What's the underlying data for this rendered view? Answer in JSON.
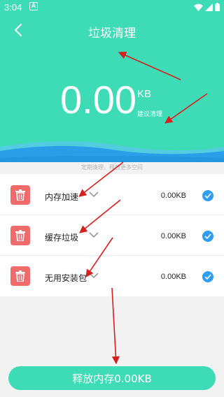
{
  "status_bar": {
    "time": "3:04",
    "notification_letter": "A"
  },
  "header": {
    "title": "垃圾清理"
  },
  "summary": {
    "value": "0.00",
    "unit": "KB",
    "subtitle": "建议清理"
  },
  "tip": "定期清理，释放更多空间",
  "items": [
    {
      "label": "内存加速",
      "size": "0.00KB",
      "checked": true
    },
    {
      "label": "缓存垃圾",
      "size": "0.00KB",
      "checked": true
    },
    {
      "label": "无用安装包",
      "size": "0.00KB",
      "checked": true
    }
  ],
  "release_button": {
    "label": "释放内存0.00KB"
  },
  "colors": {
    "accent": "#3ddcb6",
    "trash": "#f26b6b",
    "check": "#2f9ef0",
    "annotation": "#d61f1f"
  }
}
